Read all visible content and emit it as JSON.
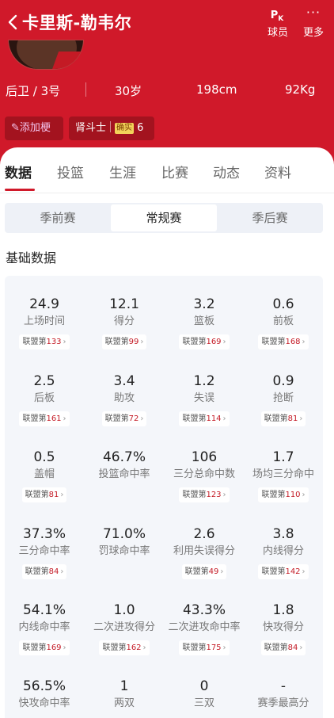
{
  "header": {
    "back_icon": "chevron-left-icon",
    "title": "卡里斯-勒韦尔",
    "pk_glyph": "PK",
    "pk_label": "球员",
    "more_glyph": "···",
    "more_label": "更多",
    "colors": {
      "primary": "#d0192a"
    }
  },
  "profile": {
    "position": "后卫 / 3号",
    "age": "30岁",
    "height": "198cm",
    "weight": "92Kg"
  },
  "chips": {
    "add_tag": "添加梗",
    "tag_name": "肾斗士",
    "tag_badge": "确实",
    "tag_count": "6"
  },
  "tabs": [
    "数据",
    "投篮",
    "生涯",
    "比赛",
    "动态",
    "资料"
  ],
  "active_tab": "数据",
  "season_tabs": [
    "季前赛",
    "常规赛",
    "季后赛"
  ],
  "active_season": "常规赛",
  "section_title": "基础数据",
  "stats": [
    {
      "value": "24.9",
      "label": "上场时间",
      "rank_prefix": "联盟第",
      "rank": "133"
    },
    {
      "value": "12.1",
      "label": "得分",
      "rank_prefix": "联盟第",
      "rank": "99"
    },
    {
      "value": "3.2",
      "label": "篮板",
      "rank_prefix": "联盟第",
      "rank": "169"
    },
    {
      "value": "0.6",
      "label": "前板",
      "rank_prefix": "联盟第",
      "rank": "168"
    },
    {
      "value": "2.5",
      "label": "后板",
      "rank_prefix": "联盟第",
      "rank": "161"
    },
    {
      "value": "3.4",
      "label": "助攻",
      "rank_prefix": "联盟第",
      "rank": "72"
    },
    {
      "value": "1.2",
      "label": "失误",
      "rank_prefix": "联盟第",
      "rank": "114"
    },
    {
      "value": "0.9",
      "label": "抢断",
      "rank_prefix": "联盟第",
      "rank": "81"
    },
    {
      "value": "0.5",
      "label": "盖帽",
      "rank_prefix": "联盟第",
      "rank": "81"
    },
    {
      "value": "46.7%",
      "label": "投篮命中率",
      "rank_prefix": "",
      "rank": ""
    },
    {
      "value": "106",
      "label": "三分总命中数",
      "rank_prefix": "联盟第",
      "rank": "123"
    },
    {
      "value": "1.7",
      "label": "场均三分命中",
      "rank_prefix": "联盟第",
      "rank": "110"
    },
    {
      "value": "37.3%",
      "label": "三分命中率",
      "rank_prefix": "联盟第",
      "rank": "84"
    },
    {
      "value": "71.0%",
      "label": "罚球命中率",
      "rank_prefix": "",
      "rank": ""
    },
    {
      "value": "2.6",
      "label": "利用失误得分",
      "rank_prefix": "联盟第",
      "rank": "49"
    },
    {
      "value": "3.8",
      "label": "内线得分",
      "rank_prefix": "联盟第",
      "rank": "142"
    },
    {
      "value": "54.1%",
      "label": "内线命中率",
      "rank_prefix": "联盟第",
      "rank": "169"
    },
    {
      "value": "1.0",
      "label": "二次进攻得分",
      "rank_prefix": "联盟第",
      "rank": "162"
    },
    {
      "value": "43.3%",
      "label": "二次进攻命中率",
      "rank_prefix": "联盟第",
      "rank": "175"
    },
    {
      "value": "1.8",
      "label": "快攻得分",
      "rank_prefix": "联盟第",
      "rank": "84"
    },
    {
      "value": "56.5%",
      "label": "快攻命中率",
      "rank_prefix": "",
      "rank": ""
    },
    {
      "value": "1",
      "label": "两双",
      "rank_prefix": "",
      "rank": ""
    },
    {
      "value": "0",
      "label": "三双",
      "rank_prefix": "",
      "rank": ""
    },
    {
      "value": "-",
      "label": "赛季最高分",
      "rank_prefix": "",
      "rank": ""
    }
  ]
}
